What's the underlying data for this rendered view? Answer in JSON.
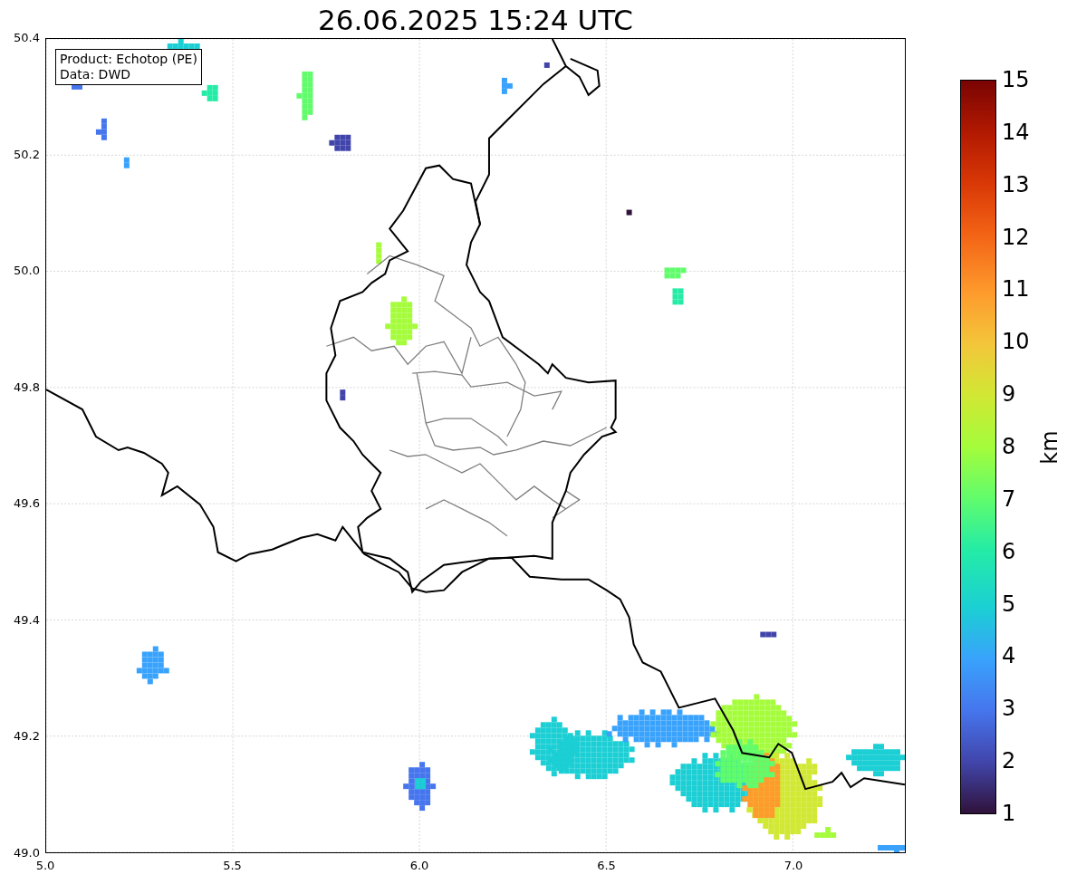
{
  "title": "26.06.2025 15:24 UTC",
  "legend": [
    "Product: Echotop (PE)",
    "Data: DWD"
  ],
  "x_axis": {
    "ticks": [
      "5.0",
      "5.5",
      "6.0",
      "6.5",
      "7.0"
    ]
  },
  "y_axis": {
    "ticks": [
      "50.4",
      "50.2",
      "50.0",
      "49.8",
      "49.6",
      "49.4",
      "49.2",
      "49.0"
    ]
  },
  "colorbar": {
    "label": "km",
    "ticks": [
      "15",
      "14",
      "13",
      "12",
      "11",
      "10",
      "9",
      "8",
      "7",
      "6",
      "5",
      "4",
      "3",
      "2",
      "1"
    ]
  }
}
